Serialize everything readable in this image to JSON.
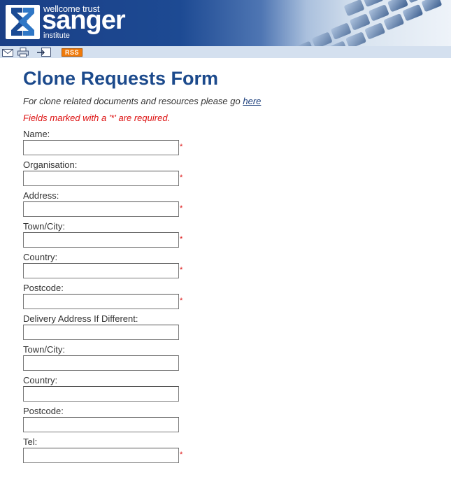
{
  "header": {
    "brand_top": "wellcome trust",
    "brand_main": "sanger",
    "brand_sub": "institute"
  },
  "toolbar": {
    "email_icon": "envelope-icon",
    "print_icon": "printer-icon",
    "share_icon": "share-icon",
    "rss_label": "RSS"
  },
  "page": {
    "title": "Clone Requests Form",
    "intro_text": "For clone related documents and resources please go ",
    "intro_link": "here",
    "required_note": "Fields marked with a '*' are required."
  },
  "form": {
    "required_marker": "*",
    "fields": [
      {
        "label": "Name:",
        "value": "",
        "required": true
      },
      {
        "label": "Organisation:",
        "value": "",
        "required": true
      },
      {
        "label": "Address:",
        "value": "",
        "required": true
      },
      {
        "label": "Town/City:",
        "value": "",
        "required": true
      },
      {
        "label": "Country:",
        "value": "",
        "required": true
      },
      {
        "label": "Postcode:",
        "value": "",
        "required": true
      },
      {
        "label": "Delivery Address If Different:",
        "value": "",
        "required": false
      },
      {
        "label": "Town/City:",
        "value": "",
        "required": false
      },
      {
        "label": "Country:",
        "value": "",
        "required": false
      },
      {
        "label": "Postcode:",
        "value": "",
        "required": false
      },
      {
        "label": "Tel:",
        "value": "",
        "required": true
      }
    ]
  },
  "colors": {
    "brand_blue": "#1d4a93",
    "title_blue": "#1c4a8c",
    "required_red": "#dd1111",
    "toolbar_bg": "#d4e0ef",
    "rss_orange": "#f07a0a"
  }
}
